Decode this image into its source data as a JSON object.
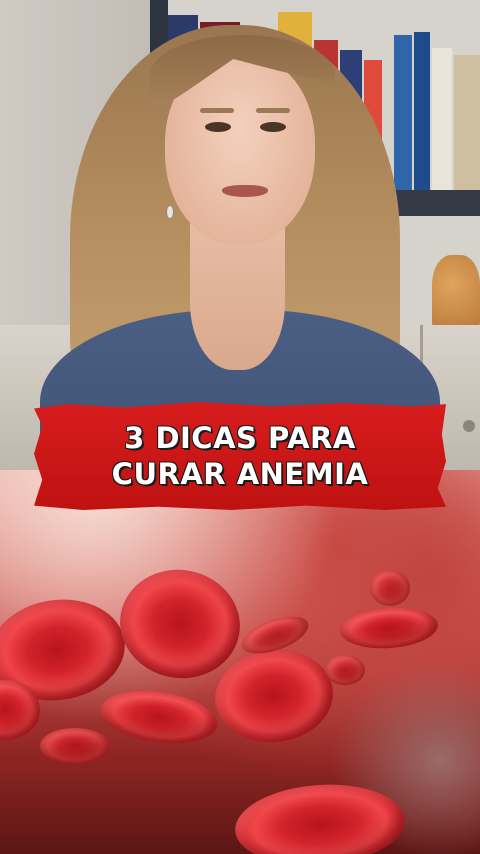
{
  "video": {
    "title_lines": [
      "3 DICAS PARA",
      "CURAR ANEMIA"
    ]
  },
  "colors": {
    "banner_red": "#d81d1d",
    "title_text": "#ffffff",
    "cell_red": "#d2232b",
    "shirt_blue": "#4a5f83"
  }
}
